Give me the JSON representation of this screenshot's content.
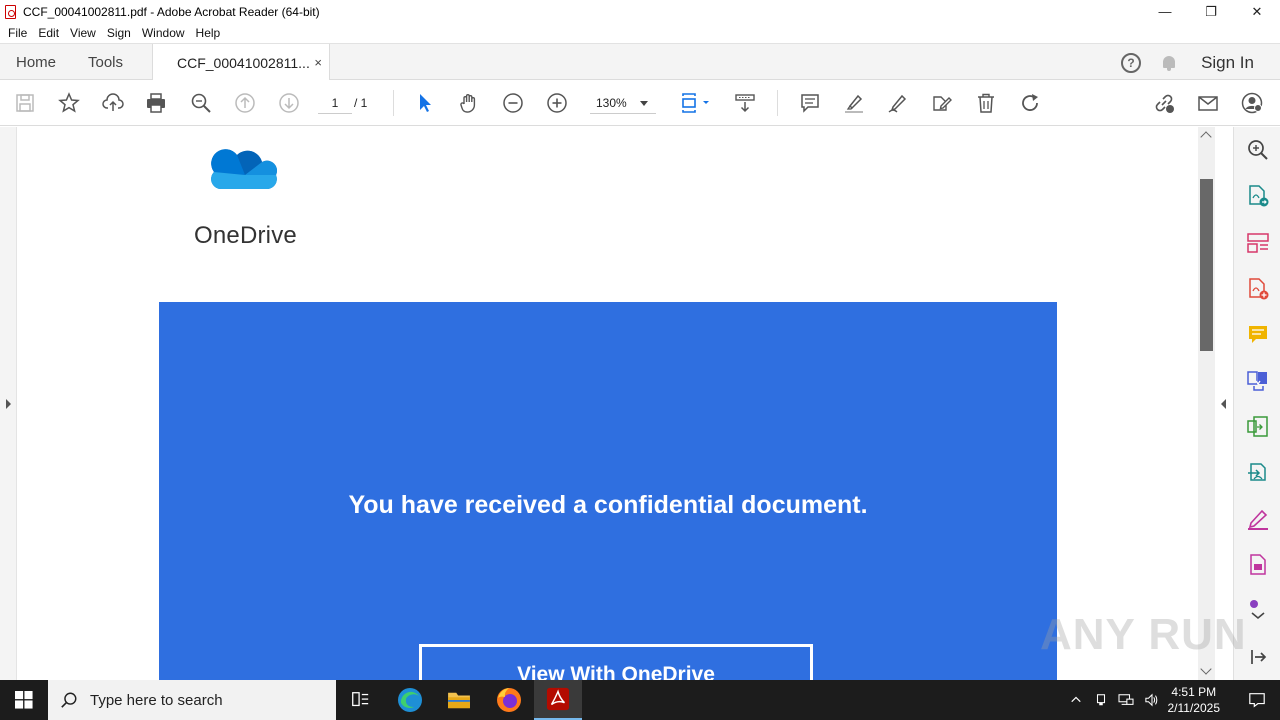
{
  "window": {
    "title": "CCF_00041002811.pdf - Adobe Acrobat Reader (64-bit)",
    "minimize": "—",
    "maximize": "❐",
    "close": "✕"
  },
  "menu": [
    "File",
    "Edit",
    "View",
    "Sign",
    "Window",
    "Help"
  ],
  "tabs": {
    "home": "Home",
    "tools": "Tools",
    "document": "CCF_00041002811...",
    "close": "×"
  },
  "header": {
    "help": "?",
    "sign_in": "Sign In"
  },
  "toolbar": {
    "page_current": "1",
    "page_total": "/ 1",
    "zoom": "130%"
  },
  "document": {
    "brand": "OneDrive",
    "message": "You have received a confidential document.",
    "button": "View With OneDrive",
    "banner_color": "#2f6fe0"
  },
  "watermark": "ANY RUN",
  "taskbar": {
    "search_placeholder": "Type here to search",
    "time": "4:51 PM",
    "date": "2/11/2025"
  },
  "icons": {
    "toolbar": [
      "save-icon",
      "bookmark-star-icon",
      "upload-icon",
      "print-icon",
      "zoom-search-icon",
      "prev-page-icon",
      "next-page-icon",
      "select-cursor-icon",
      "hand-icon",
      "zoom-out-icon",
      "zoom-in-icon",
      "page-fit-icon",
      "scroll-mode-icon",
      "comment-icon",
      "highlight-icon",
      "draw-icon",
      "edit-sign-icon",
      "delete-icon",
      "rotate-icon",
      "link-icon",
      "email-icon",
      "account-icon"
    ],
    "right_pane": [
      "search-zoom-icon",
      "export-pdf-icon",
      "organize-pages-icon",
      "create-pdf-icon",
      "comment-tool-icon",
      "combine-files-icon",
      "compress-icon",
      "export-icon",
      "fill-sign-icon",
      "document-icon",
      "more-tools-icon"
    ]
  }
}
